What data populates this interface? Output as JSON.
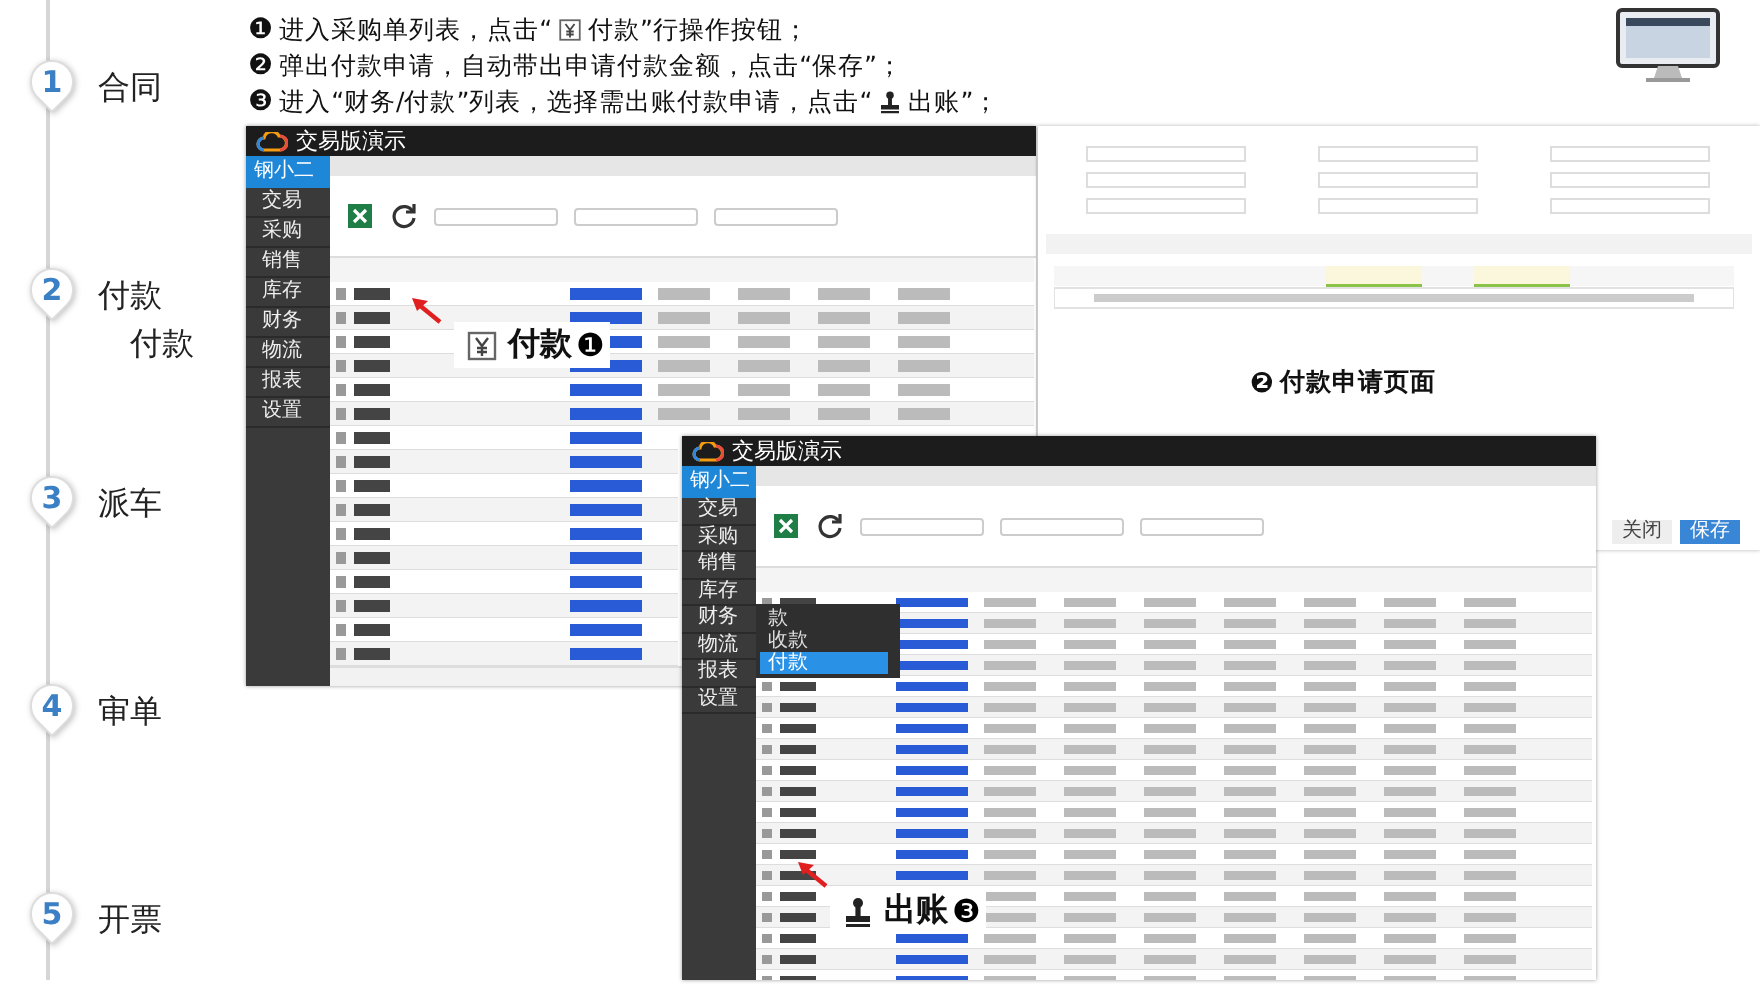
{
  "steps": [
    {
      "number": "1",
      "label": "合同"
    },
    {
      "number": "2",
      "label": "付款",
      "sub": "付款"
    },
    {
      "number": "3",
      "label": "派车"
    },
    {
      "number": "4",
      "label": "审单"
    },
    {
      "number": "5",
      "label": "开票"
    }
  ],
  "instructions": [
    {
      "marker": "❶",
      "before": "进入采购单列表，点击“",
      "after": "付款”行操作按钮；"
    },
    {
      "marker": "❷",
      "before": "弹出付款申请，自动带出申请付款金额，点击“保存”；"
    },
    {
      "marker": "❸",
      "before": "进入“财务/付款”列表，选择需出账付款申请，点击“",
      "after": "出账”；"
    }
  ],
  "purchase_list": {
    "title": "交易版演示",
    "user": "钢小二",
    "nav": [
      "交易",
      "采购",
      "销售",
      "库存",
      "财务",
      "物流",
      "报表",
      "设置"
    ],
    "callout": {
      "text": "付款",
      "marker": "❶"
    }
  },
  "payment_form": {
    "caption": {
      "marker": "❷",
      "text": "付款申请页面"
    },
    "buttons": [
      {
        "label": "关闭",
        "kind": "close"
      },
      {
        "label": "保存",
        "kind": "primary"
      }
    ]
  },
  "payment_list": {
    "title": "交易版演示",
    "user": "钢小二",
    "nav": [
      "交易",
      "采购",
      "销售",
      "库存",
      "财务",
      "物流",
      "报表",
      "设置"
    ],
    "submenu": {
      "heading": "款",
      "items": [
        {
          "label": "收款",
          "selected": false
        },
        {
          "label": "付款",
          "selected": true
        }
      ]
    },
    "callout": {
      "text": "出账",
      "marker": "❸"
    }
  }
}
